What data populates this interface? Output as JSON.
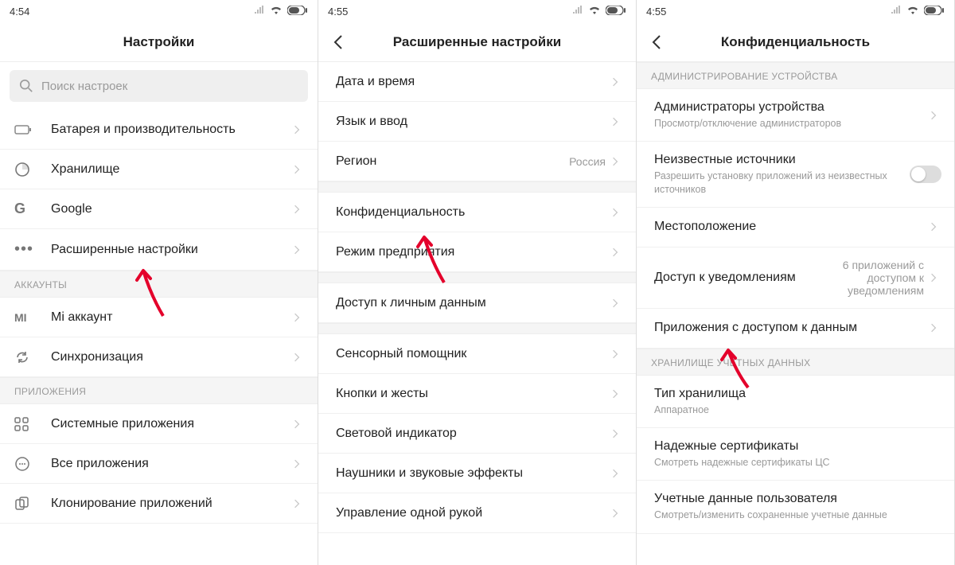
{
  "screen1": {
    "time": "4:54",
    "title": "Настройки",
    "search_placeholder": "Поиск настроек",
    "items1": [
      {
        "label": "Батарея и производительность"
      },
      {
        "label": "Хранилище"
      },
      {
        "label": "Google"
      },
      {
        "label": "Расширенные настройки"
      }
    ],
    "section_accounts": "АККАУНТЫ",
    "items_accounts": [
      {
        "label": "Mi аккаунт"
      },
      {
        "label": "Синхронизация"
      }
    ],
    "section_apps": "ПРИЛОЖЕНИЯ",
    "items_apps": [
      {
        "label": "Системные приложения"
      },
      {
        "label": "Все приложения"
      },
      {
        "label": "Клонирование приложений"
      }
    ]
  },
  "screen2": {
    "time": "4:55",
    "title": "Расширенные настройки",
    "rows": [
      {
        "label": "Дата и время"
      },
      {
        "label": "Язык и ввод"
      },
      {
        "label": "Регион",
        "value": "Россия"
      },
      {
        "label": "Конфиденциальность"
      },
      {
        "label": "Режим предприятия"
      },
      {
        "label": "Доступ к личным данным"
      },
      {
        "label": "Сенсорный помощник"
      },
      {
        "label": "Кнопки и жесты"
      },
      {
        "label": "Световой индикатор"
      },
      {
        "label": "Наушники и звуковые эффекты"
      },
      {
        "label": "Управление одной рукой"
      }
    ]
  },
  "screen3": {
    "time": "4:55",
    "title": "Конфиденциальность",
    "section_admin": "АДМИНИСТРИРОВАНИЕ УСТРОЙСТВА",
    "rows_admin": [
      {
        "label": "Администраторы устройства",
        "sub": "Просмотр/отключение администраторов"
      },
      {
        "label": "Неизвестные источники",
        "sub": "Разрешить установку приложений из неизвестных источников",
        "toggle": true
      },
      {
        "label": "Местоположение"
      },
      {
        "label": "Доступ к уведомлениям",
        "value": "6 приложений с доступом к уведомлениям"
      },
      {
        "label": "Приложения с доступом к данным"
      }
    ],
    "section_store": "ХРАНИЛИЩЕ УЧЕТНЫХ ДАННЫХ",
    "rows_store": [
      {
        "label": "Тип хранилища",
        "sub": "Аппаратное"
      },
      {
        "label": "Надежные сертификаты",
        "sub": "Смотреть надежные сертификаты ЦС"
      },
      {
        "label": "Учетные данные пользователя",
        "sub": "Смотреть/изменить сохраненные учетные данные"
      }
    ]
  }
}
